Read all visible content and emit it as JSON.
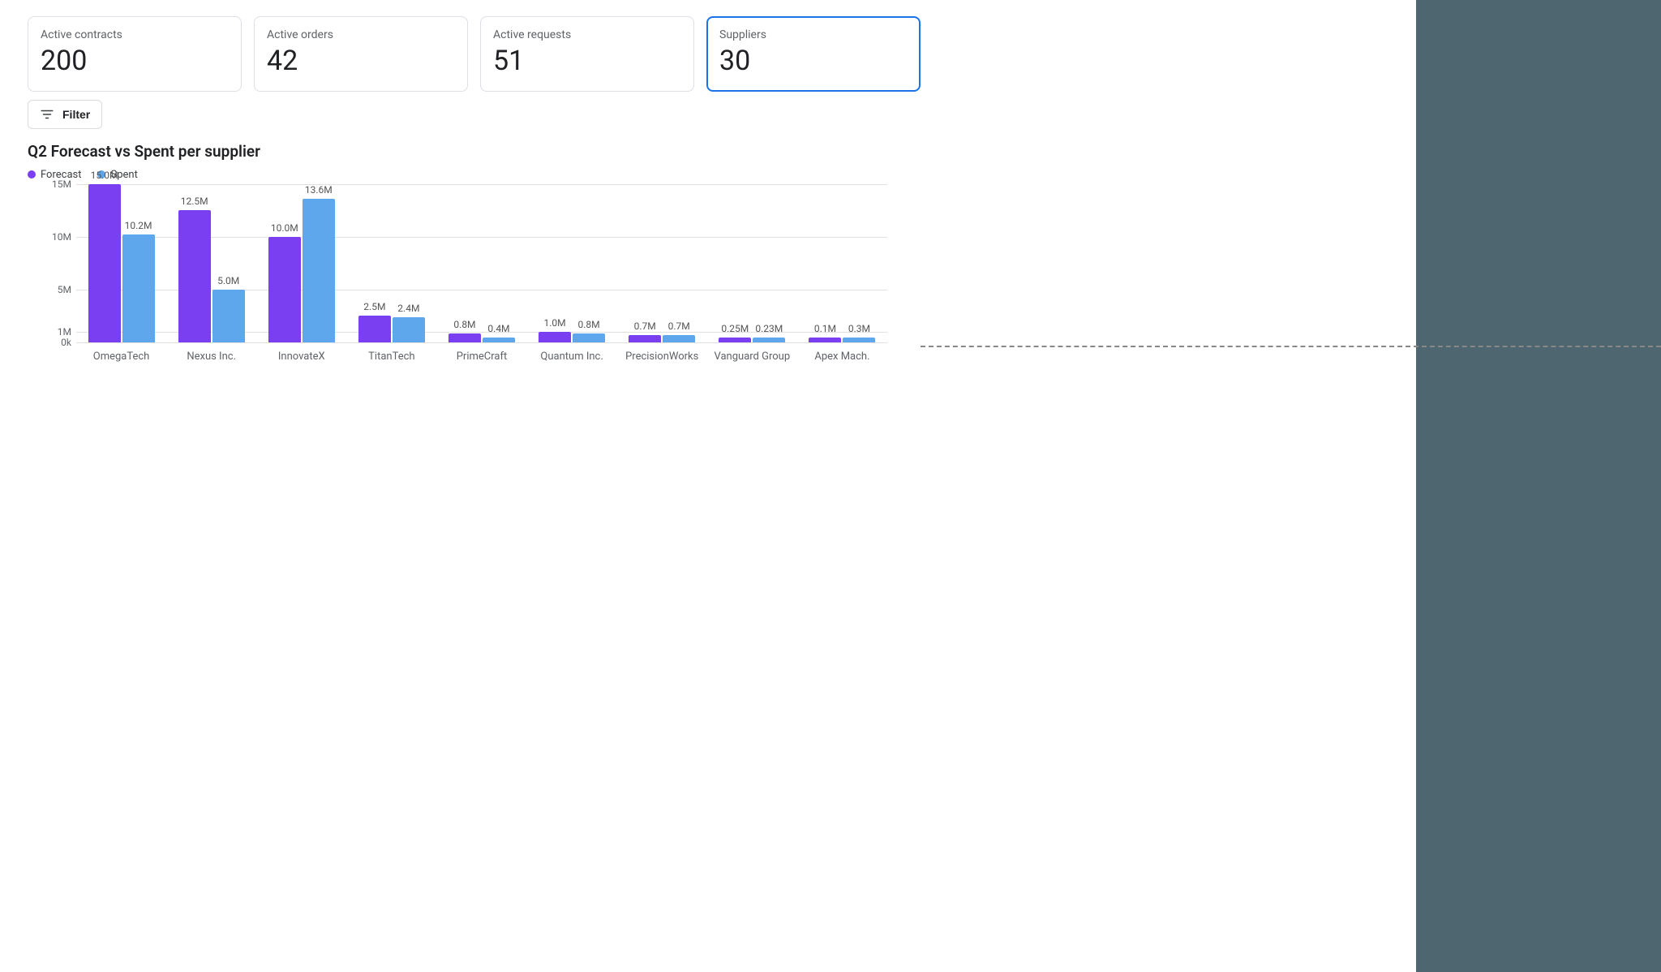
{
  "kpi": [
    {
      "label": "Active contracts",
      "value": "200",
      "active": false
    },
    {
      "label": "Active orders",
      "value": "42",
      "active": false
    },
    {
      "label": "Active requests",
      "value": "51",
      "active": false
    },
    {
      "label": "Suppliers",
      "value": "30",
      "active": true
    }
  ],
  "filter": {
    "label": "Filter"
  },
  "chart": {
    "title": "Q2 Forecast vs Spent per supplier",
    "legend": [
      {
        "name": "Forecast",
        "color": "#7b3ff2"
      },
      {
        "name": "Spent",
        "color": "#5ea7ed"
      }
    ]
  },
  "colors": {
    "forecast": "#7b3ff2",
    "spent": "#5ea7ed",
    "accent": "#1a73e8"
  },
  "chart_data": {
    "type": "bar",
    "title": "Q2 Forecast vs Spent per supplier",
    "xlabel": "",
    "ylabel": "",
    "y_ticks": [
      {
        "value": 15000000,
        "label": "15M"
      },
      {
        "value": 10000000,
        "label": "10M"
      },
      {
        "value": 5000000,
        "label": "5M"
      },
      {
        "value": 1000000,
        "label": "1M"
      },
      {
        "value": 0,
        "label": "0k"
      }
    ],
    "ylim": [
      0,
      15000000
    ],
    "categories": [
      "OmegaTech",
      "Nexus Inc.",
      "InnovateX",
      "TitanTech",
      "PrimeCraft",
      "Quantum Inc.",
      "PrecisionWorks",
      "Vanguard Group",
      "Apex Mach."
    ],
    "series": [
      {
        "name": "Forecast",
        "color": "#7b3ff2",
        "values": [
          15000000,
          12500000,
          10000000,
          2500000,
          800000,
          1000000,
          700000,
          250000,
          100000
        ],
        "value_labels": [
          "15.0M",
          "12.5M",
          "10.0M",
          "2.5M",
          "0.8M",
          "1.0M",
          "0.7M",
          "0.25M",
          "0.1M"
        ]
      },
      {
        "name": "Spent",
        "color": "#5ea7ed",
        "values": [
          10200000,
          5000000,
          13600000,
          2400000,
          400000,
          800000,
          700000,
          230000,
          300000
        ],
        "value_labels": [
          "10.2M",
          "5.0M",
          "13.6M",
          "2.4M",
          "0.4M",
          "0.8M",
          "0.7M",
          "0.23M",
          "0.3M"
        ]
      }
    ]
  }
}
